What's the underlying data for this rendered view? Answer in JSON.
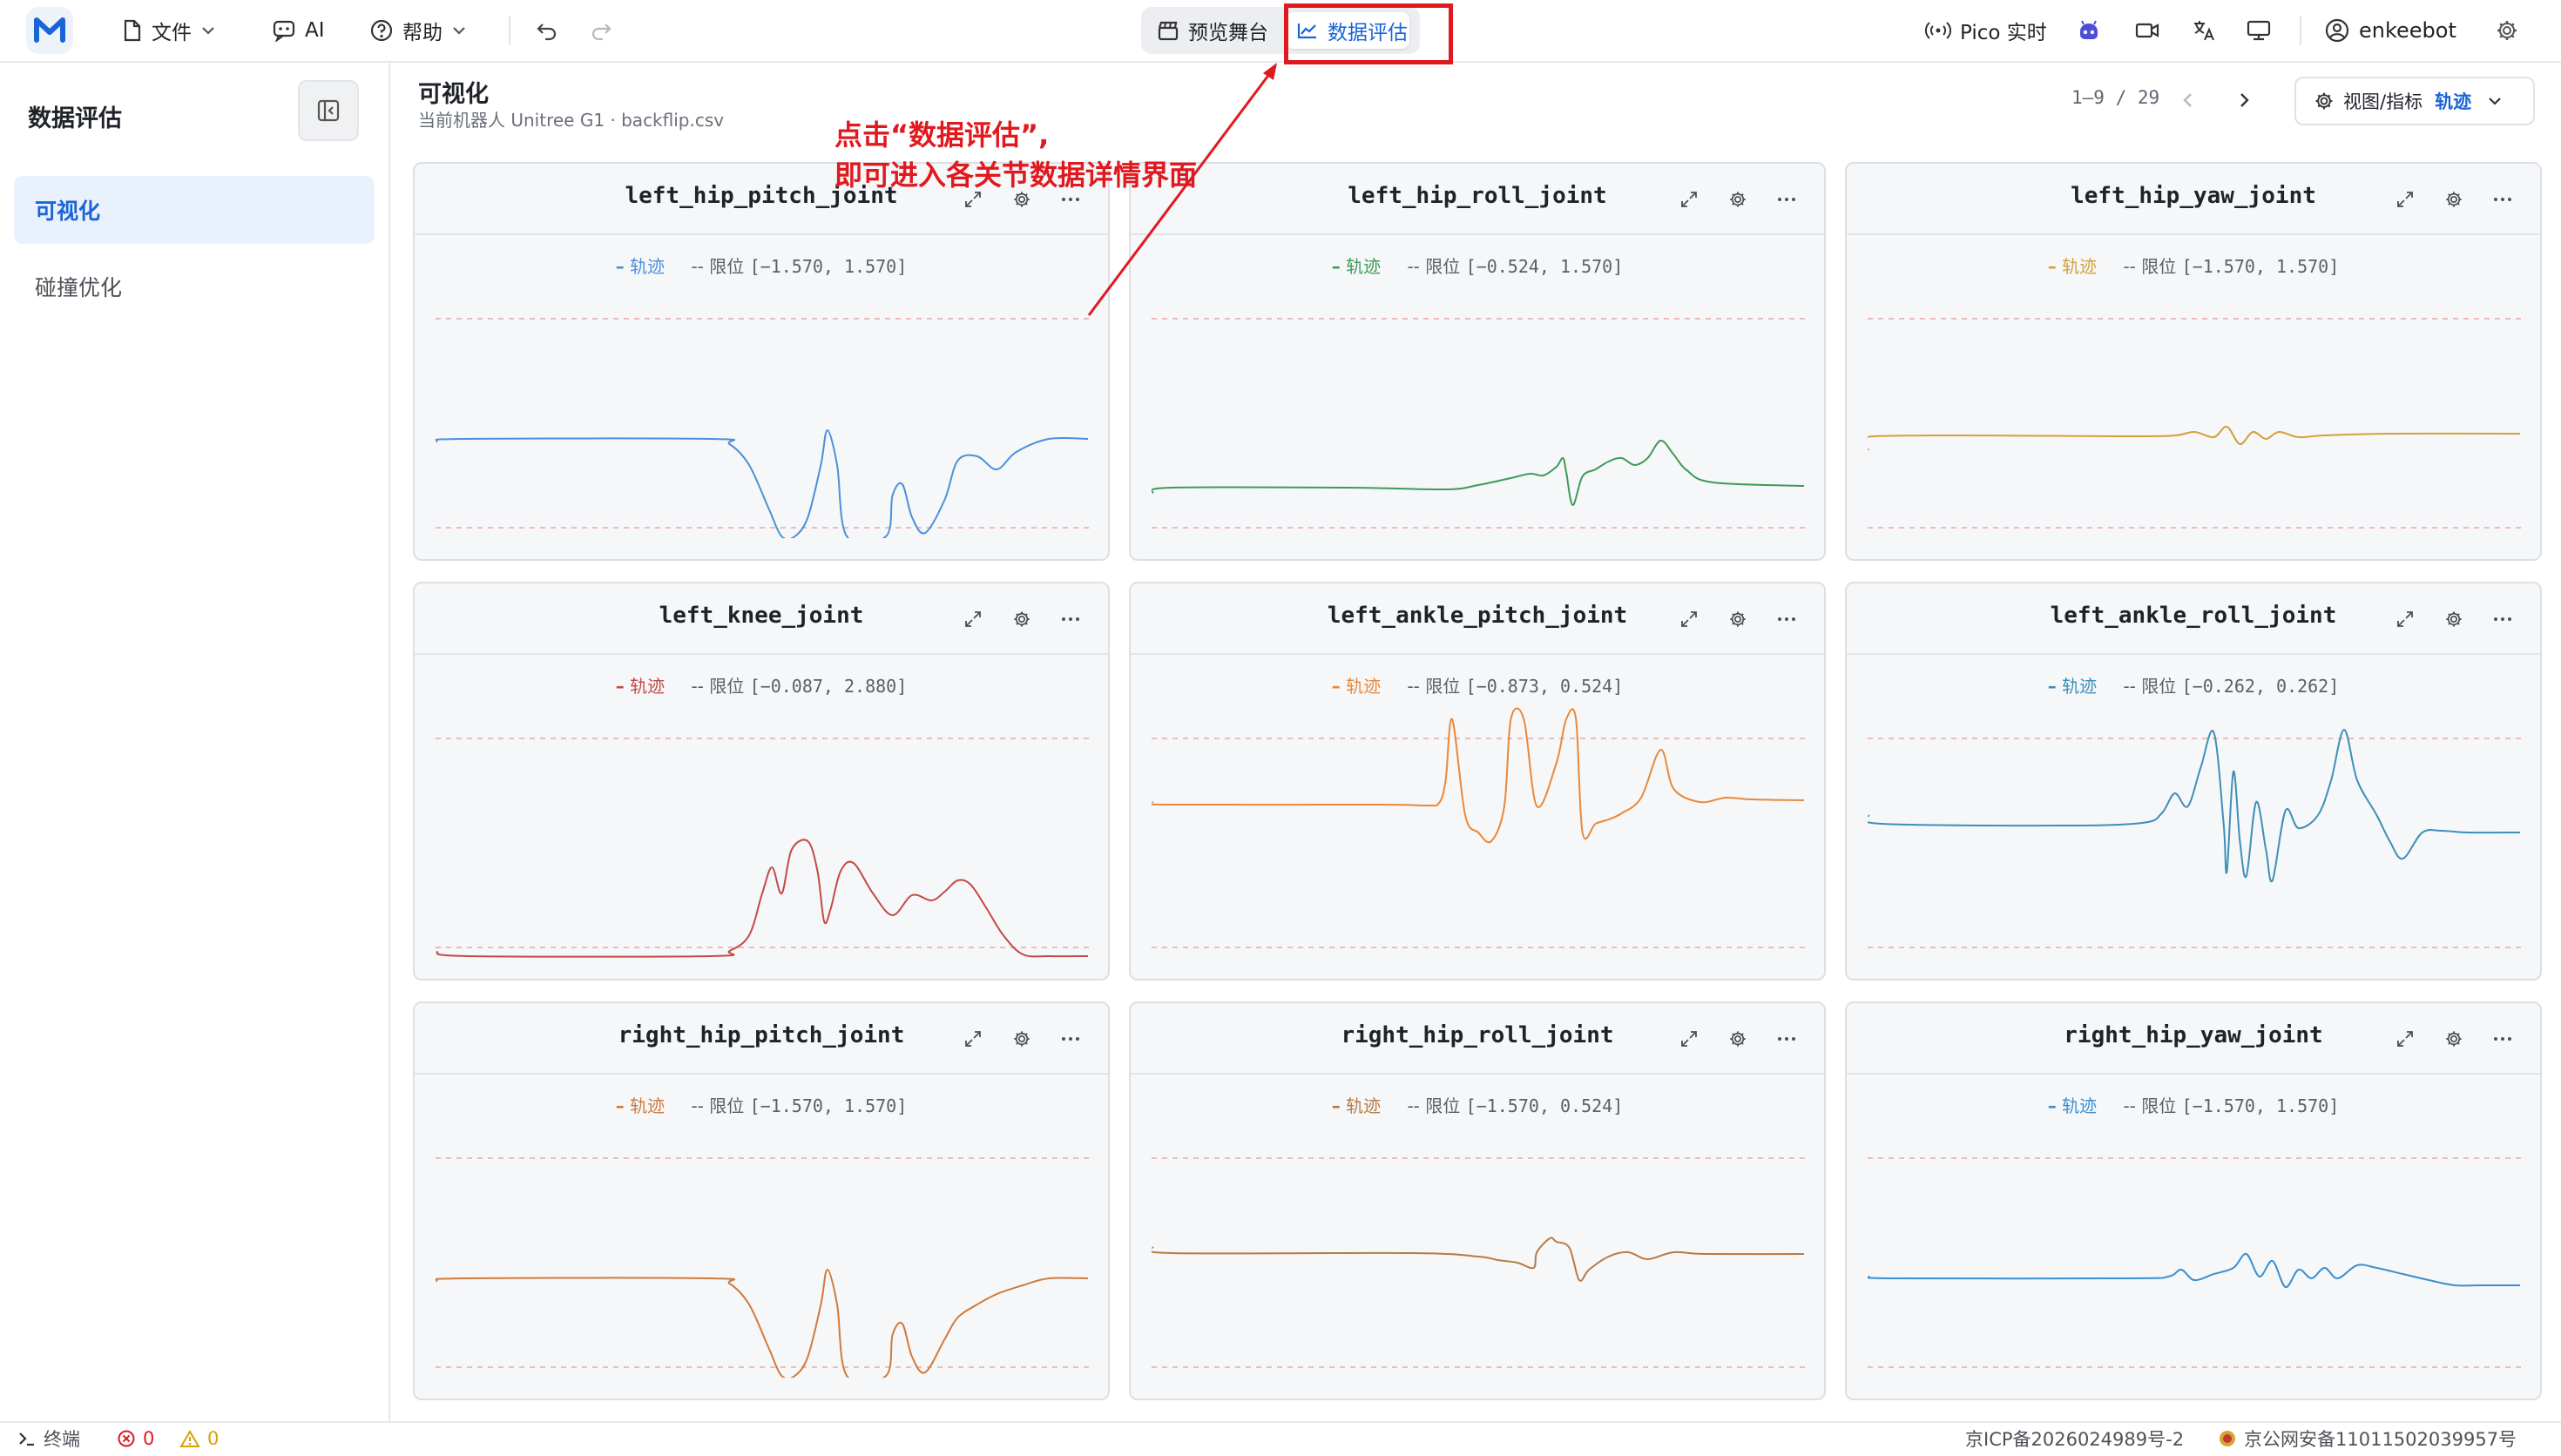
{
  "app": {
    "logo_letter": "M"
  },
  "toolbar": {
    "file_label": "文件",
    "ai_label": "AI",
    "help_label": "帮助",
    "stage_tab": "预览舞台",
    "eval_tab": "数据评估",
    "pico_label": "Pico 实时",
    "user_name": "enkeebot"
  },
  "sidebar": {
    "title": "数据评估",
    "items": [
      {
        "label": "可视化",
        "active": true
      },
      {
        "label": "碰撞优化",
        "active": false
      }
    ]
  },
  "main": {
    "title": "可视化",
    "subtitle": "当前机器人 Unitree G1 · backflip.csv",
    "pager": "1–9 / 29",
    "view_label": "视图/指标",
    "view_value": "轨迹"
  },
  "annotation": {
    "line1": "点击“数据评估”,",
    "line2": "即可进入各关节数据详情界面"
  },
  "legend": {
    "trace_label": "轨迹",
    "limit_label": "限位"
  },
  "charts": [
    {
      "title": "left_hip_pitch_joint",
      "range": "[−1.570, 1.570]",
      "color": "#4a90d9"
    },
    {
      "title": "left_hip_roll_joint",
      "range": "[−0.524, 1.570]",
      "color": "#3e9a5a"
    },
    {
      "title": "left_hip_yaw_joint",
      "range": "[−1.570, 1.570]",
      "color": "#d4a03a"
    },
    {
      "title": "left_knee_joint",
      "range": "[−0.087, 2.880]",
      "color": "#c24a46"
    },
    {
      "title": "left_ankle_pitch_joint",
      "range": "[−0.873, 0.524]",
      "color": "#e8893a"
    },
    {
      "title": "left_ankle_roll_joint",
      "range": "[−0.262, 0.262]",
      "color": "#3d8fb8"
    },
    {
      "title": "right_hip_pitch_joint",
      "range": "[−1.570, 1.570]",
      "color": "#d07a3a"
    },
    {
      "title": "right_hip_roll_joint",
      "range": "[−1.570, 0.524]",
      "color": "#b87a45"
    },
    {
      "title": "right_hip_yaw_joint",
      "range": "[−1.570, 1.570]",
      "color": "#3a8fd0"
    }
  ],
  "statusbar": {
    "terminal_label": "终端",
    "errors": "0",
    "warnings": "0",
    "icp": "京ICP备2026024989号-2",
    "police": "京公网安备11011502039957号"
  }
}
